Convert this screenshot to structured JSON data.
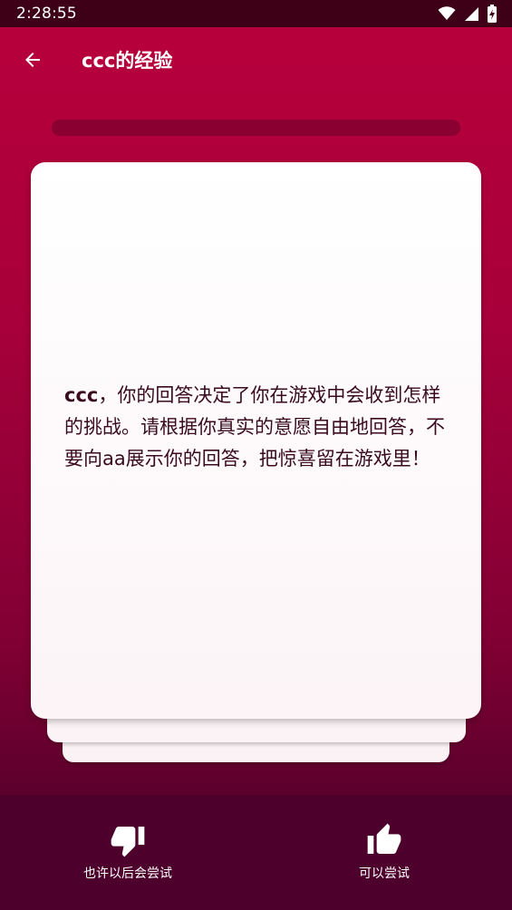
{
  "status_bar": {
    "time": "2:28:55"
  },
  "app_bar": {
    "title": "ccc的经验"
  },
  "card": {
    "name": "ccc",
    "message": "，你的回答决定了你在游戏中会收到怎样的挑战。请根据你真实的意愿自由地回答，不要向aa展示你的回答，把惊喜留在游戏里！"
  },
  "actions": {
    "dislike_label": "也许以后会尝试",
    "like_label": "可以尝试"
  },
  "colors": {
    "background_top": "#b8003c",
    "background_bottom": "#5a002c",
    "status_bar": "#3d0016",
    "bottom_bar": "#4e002c",
    "card": "#ffffff",
    "text": "#3a0a1e"
  },
  "icons": {
    "back": "arrow-left-icon",
    "wifi": "wifi-icon",
    "signal": "signal-icon",
    "battery": "battery-charging-icon",
    "dislike": "thumbs-down-icon",
    "like": "thumbs-up-icon"
  }
}
